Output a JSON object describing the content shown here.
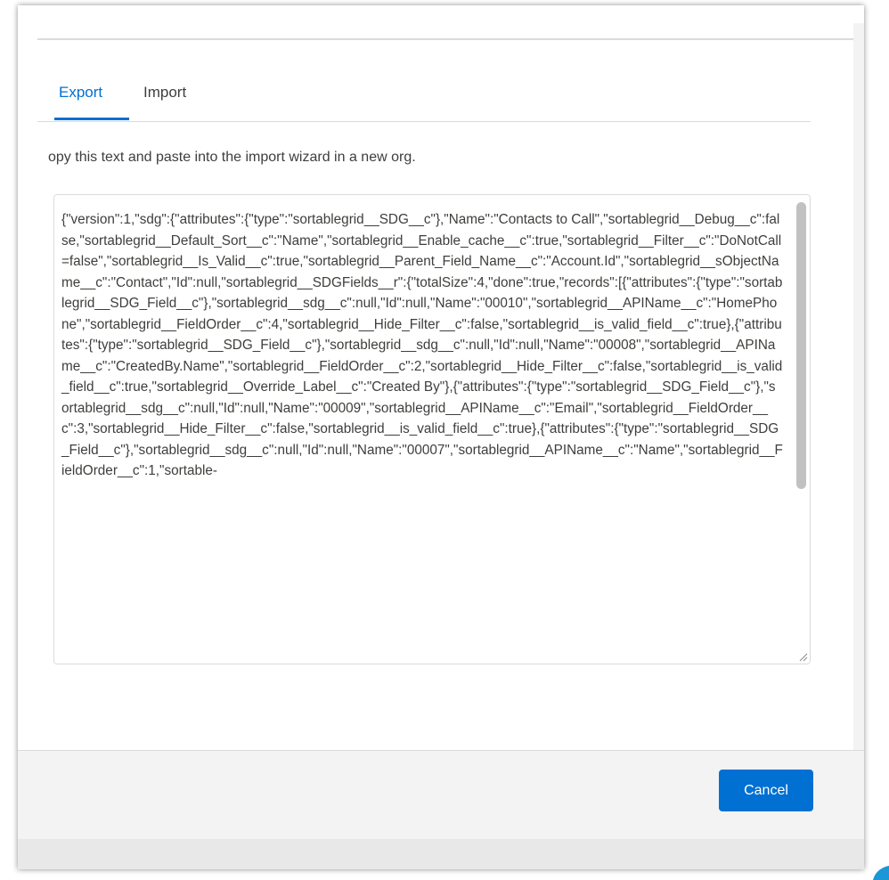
{
  "tabs": [
    {
      "label": "Export",
      "active": true
    },
    {
      "label": "Import",
      "active": false
    }
  ],
  "instructions": "opy this text and paste into the import wizard in a new org.",
  "export_text": "{\"version\":1,\"sdg\":{\"attributes\":{\"type\":\"sortablegrid__SDG__c\"},\"Name\":\"Contacts to Call\",\"sortablegrid__Debug__c\":false,\"sortablegrid__Default_Sort__c\":\"Name\",\"sortablegrid__Enable_cache__c\":true,\"sortablegrid__Filter__c\":\"DoNotCall=false\",\"sortablegrid__Is_Valid__c\":true,\"sortablegrid__Parent_Field_Name__c\":\"Account.Id\",\"sortablegrid__sObjectName__c\":\"Contact\",\"Id\":null,\"sortablegrid__SDGFields__r\":{\"totalSize\":4,\"done\":true,\"records\":[{\"attributes\":{\"type\":\"sortablegrid__SDG_Field__c\"},\"sortablegrid__sdg__c\":null,\"Id\":null,\"Name\":\"00010\",\"sortablegrid__APIName__c\":\"HomePhone\",\"sortablegrid__FieldOrder__c\":4,\"sortablegrid__Hide_Filter__c\":false,\"sortablegrid__is_valid_field__c\":true},{\"attributes\":{\"type\":\"sortablegrid__SDG_Field__c\"},\"sortablegrid__sdg__c\":null,\"Id\":null,\"Name\":\"00008\",\"sortablegrid__APIName__c\":\"CreatedBy.Name\",\"sortablegrid__FieldOrder__c\":2,\"sortablegrid__Hide_Filter__c\":false,\"sortablegrid__is_valid_field__c\":true,\"sortablegrid__Override_Label__c\":\"Created By\"},{\"attributes\":{\"type\":\"sortablegrid__SDG_Field__c\"},\"sortablegrid__sdg__c\":null,\"Id\":null,\"Name\":\"00009\",\"sortablegrid__APIName__c\":\"Email\",\"sortablegrid__FieldOrder__c\":3,\"sortablegrid__Hide_Filter__c\":false,\"sortablegrid__is_valid_field__c\":true},{\"attributes\":{\"type\":\"sortablegrid__SDG_Field__c\"},\"sortablegrid__sdg__c\":null,\"Id\":null,\"Name\":\"00007\",\"sortablegrid__APIName__c\":\"Name\",\"sortablegrid__FieldOrder__c\":1,\"sortable-",
  "footer": {
    "cancel_label": "Cancel"
  },
  "colors": {
    "accent": "#0070d2",
    "text": "#3e3e3c",
    "border": "#dddbda",
    "footer_bg": "#f3f3f3"
  }
}
